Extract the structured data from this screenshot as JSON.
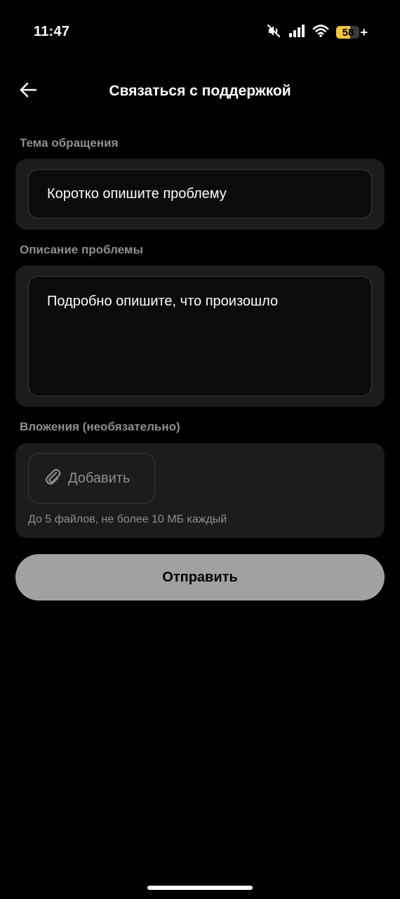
{
  "status_bar": {
    "time": "11:47",
    "battery_level": "58",
    "battery_percent": 58,
    "battery_plus": "+",
    "icons": [
      "mute-icon",
      "cellular-signal-icon",
      "wifi-icon",
      "battery-icon",
      "charging-plus-icon"
    ],
    "battery_color": "#f5c542"
  },
  "header": {
    "title": "Связаться с поддержкой",
    "back_icon": "arrow-left-icon"
  },
  "subject": {
    "label": "Тема обращения",
    "placeholder": "Коротко опишите проблему",
    "value": ""
  },
  "description": {
    "label": "Описание проблемы",
    "placeholder": "Подробно опишите, что произошло",
    "value": ""
  },
  "attachments": {
    "label": "Вложения (необязательно)",
    "add_button_label": "Добавить",
    "add_icon": "paperclip-icon",
    "hint": "До 5 файлов, не более 10 МБ каждый"
  },
  "submit": {
    "label": "Отправить"
  },
  "colors": {
    "background": "#000000",
    "card": "#1c1c1e",
    "field": "#0b0b0c",
    "muted_text": "#8e8e93",
    "submit_disabled": "#a1a1a1"
  }
}
